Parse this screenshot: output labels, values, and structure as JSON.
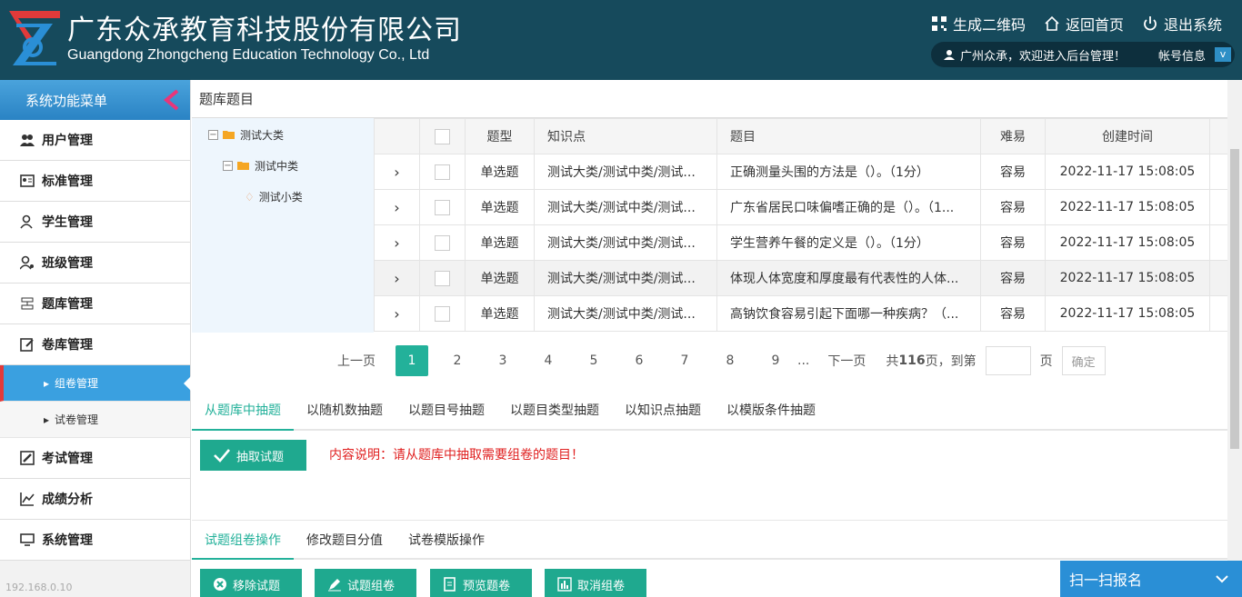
{
  "header": {
    "brand_cn": "广东众承教育科技股份有限公司",
    "brand_en": "Guangdong Zhongcheng Education Technology Co., Ltd",
    "links": [
      {
        "label": "生成二维码",
        "icon": "qrcode-icon"
      },
      {
        "label": "返回首页",
        "icon": "home-icon"
      },
      {
        "label": "退出系统",
        "icon": "power-icon"
      }
    ],
    "welcome": "广州众承，欢迎进入后台管理！",
    "account": "帐号信息",
    "account_btn": "v"
  },
  "sidebar": {
    "title": "系统功能菜单",
    "items": [
      {
        "label": "用户管理",
        "icon": "users-icon"
      },
      {
        "label": "标准管理",
        "icon": "id-card-icon"
      },
      {
        "label": "学生管理",
        "icon": "student-icon"
      },
      {
        "label": "班级管理",
        "icon": "class-icon"
      },
      {
        "label": "题库管理",
        "icon": "list-icon"
      },
      {
        "label": "卷库管理",
        "icon": "edit-icon"
      }
    ],
    "subitems": [
      {
        "label": "组卷管理"
      },
      {
        "label": "试卷管理"
      }
    ],
    "items2": [
      {
        "label": "考试管理",
        "icon": "pen-box-icon"
      },
      {
        "label": "成绩分析",
        "icon": "chart-icon"
      },
      {
        "label": "系统管理",
        "icon": "monitor-icon"
      }
    ],
    "ip": "192.168.0.10"
  },
  "main": {
    "crumb": "题库题目",
    "tree": {
      "l1": "测试大类",
      "l2": "测试中类",
      "l3": "测试小类"
    },
    "columns": [
      "题型",
      "知识点",
      "题目",
      "难易",
      "创建时间"
    ],
    "rows": [
      {
        "type": "单选题",
        "kp": "测试大类/测试中类/测试...",
        "q": "正确测量头围的方法是（）。（1分）",
        "level": "容易",
        "time": "2022-11-17 15:08:05"
      },
      {
        "type": "单选题",
        "kp": "测试大类/测试中类/测试...",
        "q": "广东省居民口味偏嗜正确的是（）。（1...",
        "level": "容易",
        "time": "2022-11-17 15:08:05"
      },
      {
        "type": "单选题",
        "kp": "测试大类/测试中类/测试...",
        "q": "学生营养午餐的定义是（）。（1分）",
        "level": "容易",
        "time": "2022-11-17 15:08:05"
      },
      {
        "type": "单选题",
        "kp": "测试大类/测试中类/测试...",
        "q": "体现人体宽度和厚度最有代表性的人体...",
        "level": "容易",
        "time": "2022-11-17 15:08:05"
      },
      {
        "type": "单选题",
        "kp": "测试大类/测试中类/测试...",
        "q": "高钠饮食容易引起下面哪一种疾病？（...",
        "level": "容易",
        "time": "2022-11-17 15:08:05"
      }
    ],
    "pager": {
      "prev": "上一页",
      "pages": [
        "1",
        "2",
        "3",
        "4",
        "5",
        "6",
        "7",
        "8",
        "9"
      ],
      "ellipsis": "...",
      "next": "下一页",
      "total_prefix": "共",
      "total": "116",
      "total_suffix": "页，到第",
      "page_word": "页",
      "confirm": "确定"
    },
    "tabs1": [
      "从题库中抽题",
      "以随机数抽题",
      "以题目号抽题",
      "以题目类型抽题",
      "以知识点抽题",
      "以模版条件抽题"
    ],
    "extract_btn": "抽取试题",
    "note": "内容说明：请从题库中抽取需要组卷的题目！",
    "tabs2": [
      "试题组卷操作",
      "修改题目分值",
      "试卷模版操作"
    ],
    "actions": [
      "移除试题",
      "试题组卷",
      "预览题卷",
      "取消组卷"
    ]
  },
  "scan": "扫一扫报名"
}
